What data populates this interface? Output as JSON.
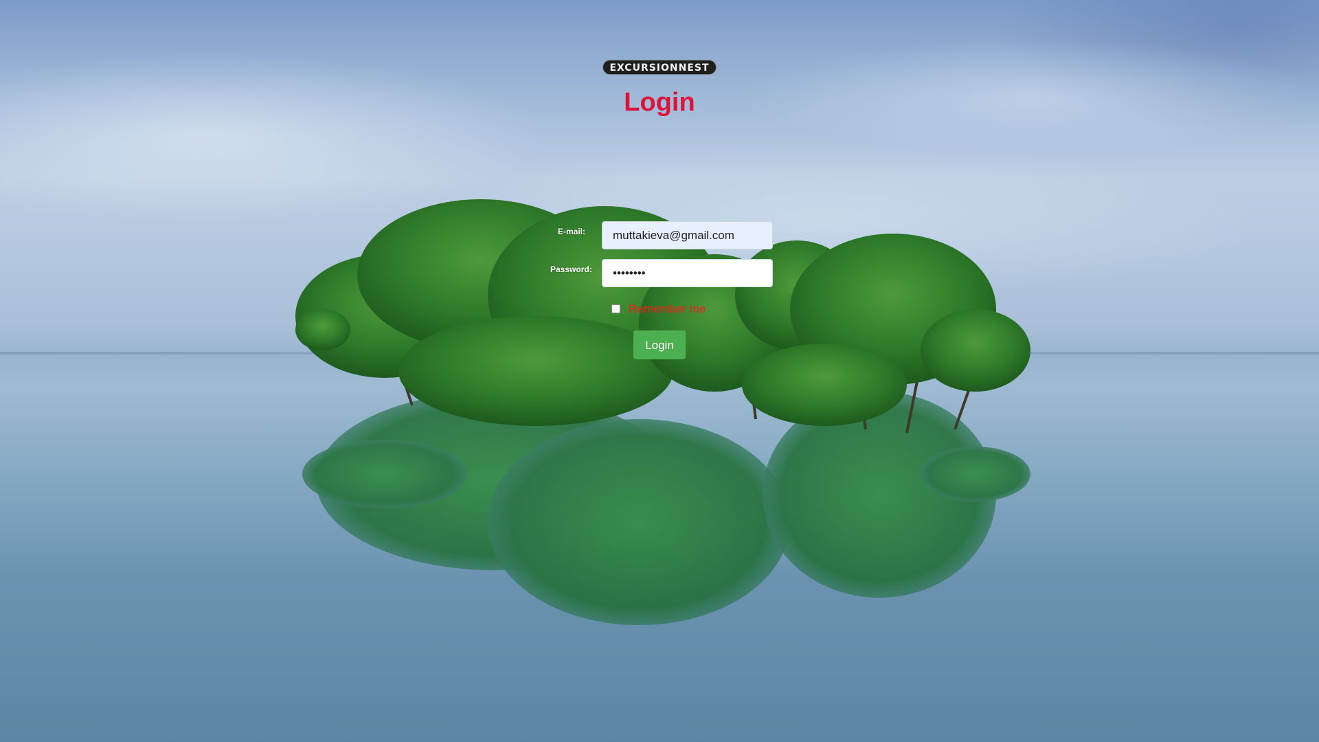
{
  "brand": {
    "logo_text": "EXCURSIONNEST"
  },
  "page": {
    "title": "Login"
  },
  "form": {
    "email_label": "E-mail:",
    "email_value": "muttakieva@gmail.com",
    "password_label": "Password:",
    "password_value": "••••••••",
    "remember_label": "Remember me",
    "remember_checked": false,
    "submit_label": "Login"
  },
  "colors": {
    "title": "#dc143c",
    "remember": "#ff1a1a",
    "button": "#4caf50"
  }
}
